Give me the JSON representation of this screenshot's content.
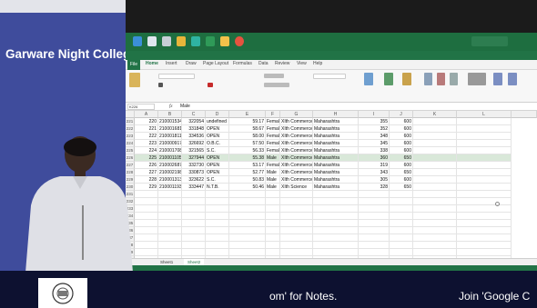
{
  "banner": {
    "college": "Garware Night College"
  },
  "bottom_ticker": {
    "left": "om' for Notes.",
    "right": "Join 'Google C"
  },
  "excel": {
    "tabs": [
      "File",
      "Home",
      "Insert",
      "Draw",
      "Page Layout",
      "Formulas",
      "Data",
      "Review",
      "View",
      "Help"
    ],
    "name_box": "K226",
    "formula_value": "Male",
    "columns": [
      "A",
      "B",
      "C",
      "D",
      "E",
      "F",
      "G",
      "H",
      "I",
      "J",
      "K",
      "L"
    ],
    "rows": [
      {
        "row": "221",
        "a": "220",
        "b": "2100015347",
        "c": "322054",
        "d": "undefined",
        "e": "59.17",
        "f": "Female",
        "g": "XIth Commerce",
        "h": "Maharashtra",
        "i": "355",
        "j": "600"
      },
      {
        "row": "222",
        "a": "221",
        "b": "2100016811",
        "c": "331848",
        "d": "OPEN",
        "e": "58.67",
        "f": "Female",
        "g": "XIth Commerce",
        "h": "Maharashtra",
        "i": "352",
        "j": "600"
      },
      {
        "row": "223",
        "a": "222",
        "b": "2100018115",
        "c": "334536",
        "d": "OPEN",
        "e": "58.00",
        "f": "Female",
        "g": "XIth Commerce",
        "h": "Maharashtra",
        "i": "348",
        "j": "600"
      },
      {
        "row": "224",
        "a": "223",
        "b": "2100009174",
        "c": "326692",
        "d": "O.B.C.",
        "e": "57.50",
        "f": "Female",
        "g": "XIth Commerce",
        "h": "Maharashtra",
        "i": "345",
        "j": "600"
      },
      {
        "row": "225",
        "a": "224",
        "b": "2100017087",
        "c": "321565",
        "d": "S.C.",
        "e": "56.33",
        "f": "Female",
        "g": "XIth Commerce",
        "h": "Maharashtra",
        "i": "338",
        "j": "600"
      },
      {
        "row": "226",
        "a": "225",
        "b": "2100011058",
        "c": "327944",
        "d": "OPEN",
        "e": "55.38",
        "f": "Male",
        "g": "XIth Commerce",
        "h": "Maharashtra",
        "i": "360",
        "j": "650"
      },
      {
        "row": "227",
        "a": "226",
        "b": "2100026878",
        "c": "332730",
        "d": "OPEN",
        "e": "53.17",
        "f": "Female",
        "g": "XIth Commerce",
        "h": "Maharashtra",
        "i": "319",
        "j": "600"
      },
      {
        "row": "228",
        "a": "227",
        "b": "2100021985",
        "c": "330873",
        "d": "OPEN",
        "e": "52.77",
        "f": "Male",
        "g": "XIth Commerce",
        "h": "Maharashtra",
        "i": "343",
        "j": "650"
      },
      {
        "row": "229",
        "a": "228",
        "b": "2100013130",
        "c": "323622",
        "d": "S.C.",
        "e": "50.83",
        "f": "Male",
        "g": "XIth Commerce",
        "h": "Maharashtra",
        "i": "305",
        "j": "600"
      },
      {
        "row": "230",
        "a": "229",
        "b": "2100011930",
        "c": "333447",
        "d": "N.T.B.",
        "e": "50.46",
        "f": "Male",
        "g": "XIth Science",
        "h": "Maharashtra",
        "i": "328",
        "j": "650"
      },
      {
        "row": "231"
      },
      {
        "row": "232"
      },
      {
        "row": "233"
      },
      {
        "row": "234"
      },
      {
        "row": "235"
      },
      {
        "row": "236"
      },
      {
        "row": "237"
      },
      {
        "row": "238"
      },
      {
        "row": "239"
      },
      {
        "row": "240"
      }
    ],
    "sheet_tabs": [
      "Sheet1",
      "Sheet2"
    ],
    "colors": {
      "excel_green": "#217346",
      "banner_blue": "#3f4c9c",
      "selection": "#d9e8d9"
    }
  }
}
